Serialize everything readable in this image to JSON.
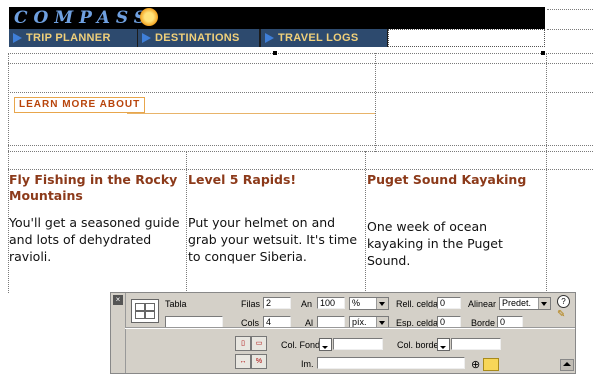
{
  "logo": {
    "text": "COMPASS"
  },
  "nav": {
    "items": [
      "TRIP PLANNER",
      "DESTINATIONS",
      "TRAVEL LOGS"
    ]
  },
  "section_label": "LEARN MORE ABOUT",
  "articles": [
    {
      "title": "Fly Fishing in the Rocky Mountains",
      "body": "You'll get a seasoned guide and lots of dehydrated ravioli."
    },
    {
      "title": "Level 5 Rapids!",
      "body": "Put your helmet on and grab your wetsuit. It's time to conquer Siberia."
    },
    {
      "title": "Puget Sound Kayaking",
      "body": "One week of ocean kayaking in the Puget Sound."
    }
  ],
  "inspector": {
    "tabla_label": "Tabla",
    "tabla_value": "",
    "filas_label": "Filas",
    "filas_value": "2",
    "cols_label": "Cols",
    "cols_value": "4",
    "an_label": "An",
    "an_value": "100",
    "an_unit": "%",
    "al_label": "Al",
    "al_value": "",
    "al_unit": "píx.",
    "rell_label": "Rell. celda",
    "rell_value": "0",
    "esp_label": "Esp. celda",
    "esp_value": "0",
    "alinear_label": "Alinear",
    "alinear_value": "Predet.",
    "borde_label": "Borde",
    "borde_value": "0",
    "colfondo_label": "Col. Fondo",
    "colborde_label": "Col. borde",
    "im_label": "Im.",
    "im_value": ""
  },
  "colors": {
    "nav_bg": "#2d4a6e",
    "nav_text": "#f0d07a",
    "heading": "#8c3a1a",
    "accent": "#e8a64c"
  }
}
